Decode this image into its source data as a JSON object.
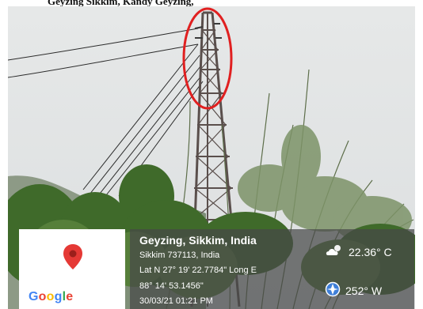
{
  "header": {
    "caption": "Geyzing Sikkim, Kandy Geyzing,"
  },
  "photo": {
    "subject": "transmission-tower-with-red-highlight-circle",
    "highlight_color": "#e02020",
    "sky_color": "#e4e6e6"
  },
  "map_card": {
    "pin_icon": "map-pin-icon",
    "pin_color": "#e53935",
    "logo_text": "Google",
    "logo_letters": [
      {
        "char": "G",
        "color": "#4285F4"
      },
      {
        "char": "o",
        "color": "#EA4335"
      },
      {
        "char": "o",
        "color": "#FBBC05"
      },
      {
        "char": "g",
        "color": "#4285F4"
      },
      {
        "char": "l",
        "color": "#34A853"
      },
      {
        "char": "e",
        "color": "#EA4335"
      }
    ]
  },
  "location": {
    "title": "Geyzing, Sikkim, India",
    "address": "Sikkim 737113, India",
    "coords_line1": "Lat N 27° 19' 22.7784\" Long E",
    "coords_line2": "88° 14' 53.1456\"",
    "datetime": "30/03/21 01:21 PM"
  },
  "weather": {
    "icon": "partly-cloudy-icon",
    "temperature": "22.36° C"
  },
  "wind": {
    "icon": "compass-icon",
    "direction": "252° W"
  }
}
